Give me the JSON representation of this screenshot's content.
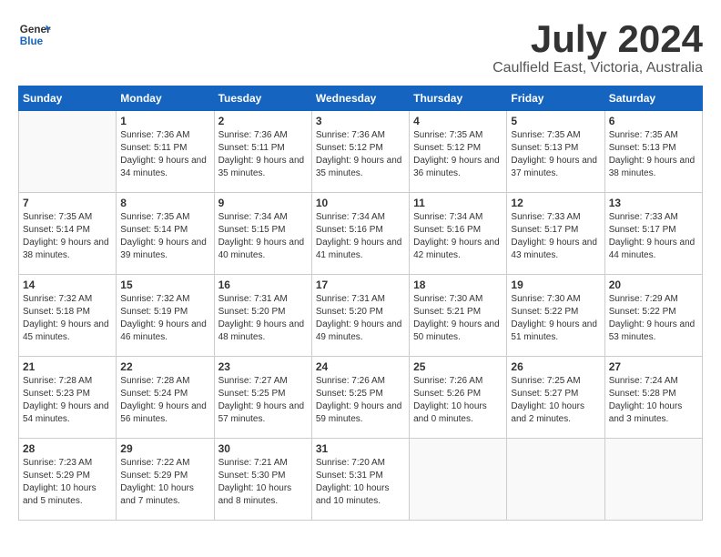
{
  "header": {
    "logo_line1": "General",
    "logo_line2": "Blue",
    "month": "July 2024",
    "location": "Caulfield East, Victoria, Australia"
  },
  "weekdays": [
    "Sunday",
    "Monday",
    "Tuesday",
    "Wednesday",
    "Thursday",
    "Friday",
    "Saturday"
  ],
  "weeks": [
    [
      {
        "day": "",
        "sunrise": "",
        "sunset": "",
        "daylight": ""
      },
      {
        "day": "1",
        "sunrise": "Sunrise: 7:36 AM",
        "sunset": "Sunset: 5:11 PM",
        "daylight": "Daylight: 9 hours and 34 minutes."
      },
      {
        "day": "2",
        "sunrise": "Sunrise: 7:36 AM",
        "sunset": "Sunset: 5:11 PM",
        "daylight": "Daylight: 9 hours and 35 minutes."
      },
      {
        "day": "3",
        "sunrise": "Sunrise: 7:36 AM",
        "sunset": "Sunset: 5:12 PM",
        "daylight": "Daylight: 9 hours and 35 minutes."
      },
      {
        "day": "4",
        "sunrise": "Sunrise: 7:35 AM",
        "sunset": "Sunset: 5:12 PM",
        "daylight": "Daylight: 9 hours and 36 minutes."
      },
      {
        "day": "5",
        "sunrise": "Sunrise: 7:35 AM",
        "sunset": "Sunset: 5:13 PM",
        "daylight": "Daylight: 9 hours and 37 minutes."
      },
      {
        "day": "6",
        "sunrise": "Sunrise: 7:35 AM",
        "sunset": "Sunset: 5:13 PM",
        "daylight": "Daylight: 9 hours and 38 minutes."
      }
    ],
    [
      {
        "day": "7",
        "sunrise": "Sunrise: 7:35 AM",
        "sunset": "Sunset: 5:14 PM",
        "daylight": "Daylight: 9 hours and 38 minutes."
      },
      {
        "day": "8",
        "sunrise": "Sunrise: 7:35 AM",
        "sunset": "Sunset: 5:14 PM",
        "daylight": "Daylight: 9 hours and 39 minutes."
      },
      {
        "day": "9",
        "sunrise": "Sunrise: 7:34 AM",
        "sunset": "Sunset: 5:15 PM",
        "daylight": "Daylight: 9 hours and 40 minutes."
      },
      {
        "day": "10",
        "sunrise": "Sunrise: 7:34 AM",
        "sunset": "Sunset: 5:16 PM",
        "daylight": "Daylight: 9 hours and 41 minutes."
      },
      {
        "day": "11",
        "sunrise": "Sunrise: 7:34 AM",
        "sunset": "Sunset: 5:16 PM",
        "daylight": "Daylight: 9 hours and 42 minutes."
      },
      {
        "day": "12",
        "sunrise": "Sunrise: 7:33 AM",
        "sunset": "Sunset: 5:17 PM",
        "daylight": "Daylight: 9 hours and 43 minutes."
      },
      {
        "day": "13",
        "sunrise": "Sunrise: 7:33 AM",
        "sunset": "Sunset: 5:17 PM",
        "daylight": "Daylight: 9 hours and 44 minutes."
      }
    ],
    [
      {
        "day": "14",
        "sunrise": "Sunrise: 7:32 AM",
        "sunset": "Sunset: 5:18 PM",
        "daylight": "Daylight: 9 hours and 45 minutes."
      },
      {
        "day": "15",
        "sunrise": "Sunrise: 7:32 AM",
        "sunset": "Sunset: 5:19 PM",
        "daylight": "Daylight: 9 hours and 46 minutes."
      },
      {
        "day": "16",
        "sunrise": "Sunrise: 7:31 AM",
        "sunset": "Sunset: 5:20 PM",
        "daylight": "Daylight: 9 hours and 48 minutes."
      },
      {
        "day": "17",
        "sunrise": "Sunrise: 7:31 AM",
        "sunset": "Sunset: 5:20 PM",
        "daylight": "Daylight: 9 hours and 49 minutes."
      },
      {
        "day": "18",
        "sunrise": "Sunrise: 7:30 AM",
        "sunset": "Sunset: 5:21 PM",
        "daylight": "Daylight: 9 hours and 50 minutes."
      },
      {
        "day": "19",
        "sunrise": "Sunrise: 7:30 AM",
        "sunset": "Sunset: 5:22 PM",
        "daylight": "Daylight: 9 hours and 51 minutes."
      },
      {
        "day": "20",
        "sunrise": "Sunrise: 7:29 AM",
        "sunset": "Sunset: 5:22 PM",
        "daylight": "Daylight: 9 hours and 53 minutes."
      }
    ],
    [
      {
        "day": "21",
        "sunrise": "Sunrise: 7:28 AM",
        "sunset": "Sunset: 5:23 PM",
        "daylight": "Daylight: 9 hours and 54 minutes."
      },
      {
        "day": "22",
        "sunrise": "Sunrise: 7:28 AM",
        "sunset": "Sunset: 5:24 PM",
        "daylight": "Daylight: 9 hours and 56 minutes."
      },
      {
        "day": "23",
        "sunrise": "Sunrise: 7:27 AM",
        "sunset": "Sunset: 5:25 PM",
        "daylight": "Daylight: 9 hours and 57 minutes."
      },
      {
        "day": "24",
        "sunrise": "Sunrise: 7:26 AM",
        "sunset": "Sunset: 5:25 PM",
        "daylight": "Daylight: 9 hours and 59 minutes."
      },
      {
        "day": "25",
        "sunrise": "Sunrise: 7:26 AM",
        "sunset": "Sunset: 5:26 PM",
        "daylight": "Daylight: 10 hours and 0 minutes."
      },
      {
        "day": "26",
        "sunrise": "Sunrise: 7:25 AM",
        "sunset": "Sunset: 5:27 PM",
        "daylight": "Daylight: 10 hours and 2 minutes."
      },
      {
        "day": "27",
        "sunrise": "Sunrise: 7:24 AM",
        "sunset": "Sunset: 5:28 PM",
        "daylight": "Daylight: 10 hours and 3 minutes."
      }
    ],
    [
      {
        "day": "28",
        "sunrise": "Sunrise: 7:23 AM",
        "sunset": "Sunset: 5:29 PM",
        "daylight": "Daylight: 10 hours and 5 minutes."
      },
      {
        "day": "29",
        "sunrise": "Sunrise: 7:22 AM",
        "sunset": "Sunset: 5:29 PM",
        "daylight": "Daylight: 10 hours and 7 minutes."
      },
      {
        "day": "30",
        "sunrise": "Sunrise: 7:21 AM",
        "sunset": "Sunset: 5:30 PM",
        "daylight": "Daylight: 10 hours and 8 minutes."
      },
      {
        "day": "31",
        "sunrise": "Sunrise: 7:20 AM",
        "sunset": "Sunset: 5:31 PM",
        "daylight": "Daylight: 10 hours and 10 minutes."
      },
      {
        "day": "",
        "sunrise": "",
        "sunset": "",
        "daylight": ""
      },
      {
        "day": "",
        "sunrise": "",
        "sunset": "",
        "daylight": ""
      },
      {
        "day": "",
        "sunrise": "",
        "sunset": "",
        "daylight": ""
      }
    ]
  ]
}
